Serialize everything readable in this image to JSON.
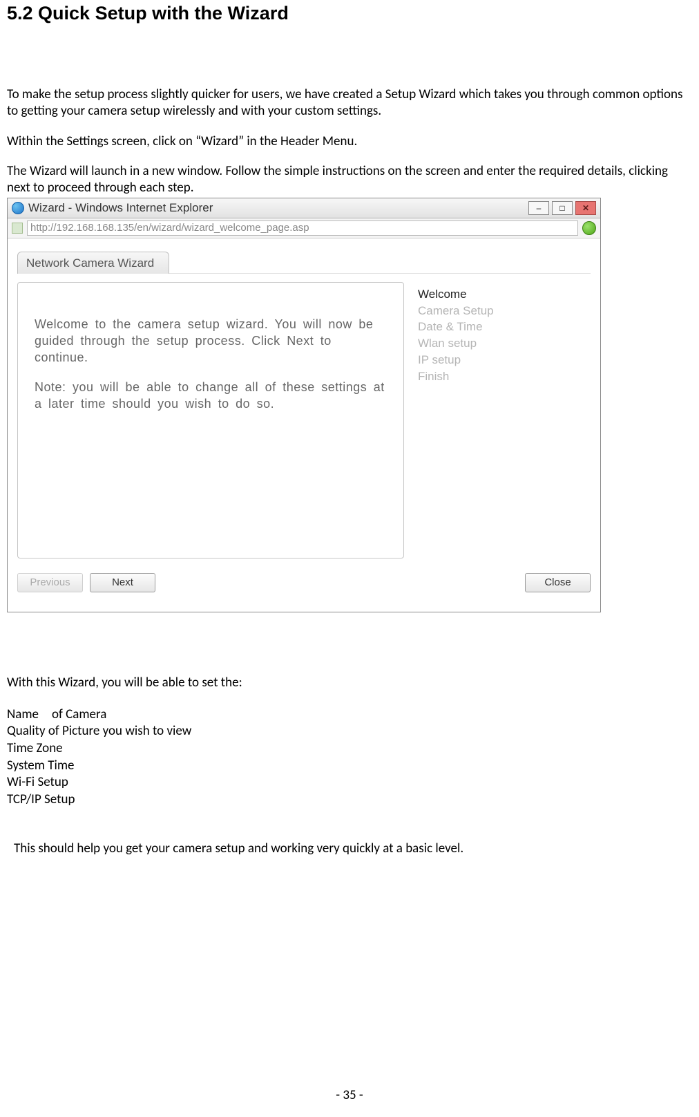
{
  "heading": "5.2 Quick Setup with the Wizard",
  "intro_para": "To make the setup process slightly quicker for users, we have created a Setup Wizard which takes you through common options to getting your camera setup wirelessly and with your custom settings.",
  "para2": "Within the Settings screen, click on “Wizard” in the Header Menu.",
  "para3": "The Wizard will launch in a new window. Follow the simple instructions on the screen and enter the required details, clicking next to proceed through each step.",
  "browser": {
    "title": "Wizard - Windows Internet Explorer",
    "url": "http://192.168.168.135/en/wizard/wizard_welcome_page.asp",
    "min_label": "–",
    "max_label": "□",
    "close_label": "✕"
  },
  "wizard": {
    "tab_title": "Network Camera Wizard",
    "welcome_p1": "Welcome to the camera setup wizard. You will now be guided through the setup process. Click Next to continue.",
    "welcome_p2": "Note: you will be able to change all of these settings at a later time should you wish to do so.",
    "steps": [
      "Welcome",
      "Camera Setup",
      "Date & Time",
      "Wlan setup",
      "IP setup",
      "Finish"
    ],
    "btn_prev": "Previous",
    "btn_next": "Next",
    "btn_close": "Close"
  },
  "post_intro": "With this Wizard, you will be able to set the:",
  "set_items": [
    "Name of Camera",
    "Quality of Picture you wish to view",
    "Time Zone",
    "System Time",
    "Wi-Fi Setup",
    "TCP/IP Setup"
  ],
  "closing": "This should help you get your camera setup and working very quickly at a basic level.",
  "page_number": "- 35 -"
}
